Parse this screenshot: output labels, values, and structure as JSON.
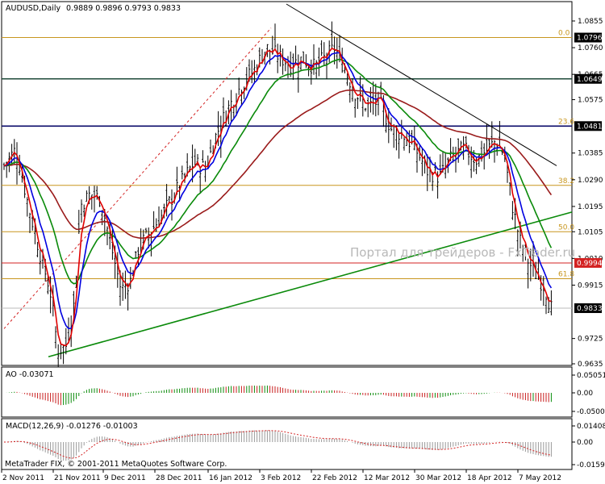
{
  "header": {
    "symbol": "AUDUSD,Daily",
    "ohlc": "0.9889 0.9896 0.9793 0.9833"
  },
  "watermark": "Портал для трейдеров - FxTrader.ru",
  "copyright": "MetaTrader FIX, © 2001-2011 MetaQuotes Software Corp.",
  "price_ticks": [
    "1.0855",
    "1.0760",
    "1.0665",
    "1.0575",
    "1.0385",
    "1.0290",
    "1.0195",
    "1.0105",
    "1.0010",
    "0.9915",
    "0.9725",
    "0.9635"
  ],
  "price_labels": [
    {
      "text": "1.0796",
      "color": "#000000"
    },
    {
      "text": "1.0649",
      "color": "#000000"
    },
    {
      "text": "1.0481",
      "color": "#000000"
    },
    {
      "text": "0.9994",
      "color": "#d32222"
    },
    {
      "text": "0.9833",
      "color": "#000000"
    }
  ],
  "fib_levels": [
    {
      "label": "0.0",
      "price": 1.0796
    },
    {
      "label": "23.6",
      "price": 1.0481
    },
    {
      "label": "38.2",
      "price": 1.027
    },
    {
      "label": "50.0",
      "price": 1.0105
    },
    {
      "label": "61.8",
      "price": 0.9938
    }
  ],
  "x_labels": [
    "2 Nov 2011",
    "21 Nov 2011",
    "9 Dec 2011",
    "28 Dec 2011",
    "16 Jan 2012",
    "3 Feb 2012",
    "22 Feb 2012",
    "12 Mar 2012",
    "30 Mar 2012",
    "18 Apr 2012",
    "7 May 2012"
  ],
  "ao": {
    "label": "AO -0.03071",
    "ticks": [
      "0.05051",
      "0.00",
      "-0.05002"
    ]
  },
  "macd": {
    "label": "MACD(12,26,9) -0.01276 -0.01003",
    "ticks": [
      "0.01408",
      "0.00",
      "-0.01597"
    ]
  },
  "colors": {
    "price_bars": "#000000",
    "ma_fast": "#e00000",
    "ma_blue": "#0000e0",
    "ma_green": "#0a8a0a",
    "ma_brown": "#9a1b1b",
    "fib": "#c8961e",
    "trend_green": "#0a8a0a",
    "ao_up": "#0a8a0a",
    "ao_down": "#c81e1e"
  },
  "chart_data": {
    "type": "line",
    "title": "AUDUSD,Daily",
    "x": [
      "2 Nov 2011",
      "21 Nov 2011",
      "9 Dec 2011",
      "28 Dec 2011",
      "16 Jan 2012",
      "3 Feb 2012",
      "22 Feb 2012",
      "12 Mar 2012",
      "30 Mar 2012",
      "18 Apr 2012",
      "7 May 2012"
    ],
    "series": [
      {
        "name": "close",
        "values": [
          1.034,
          0.968,
          0.993,
          1.018,
          1.045,
          1.077,
          1.07,
          1.046,
          1.038,
          1.038,
          0.983
        ]
      }
    ],
    "ylim": [
      0.9635,
      1.0855
    ]
  }
}
